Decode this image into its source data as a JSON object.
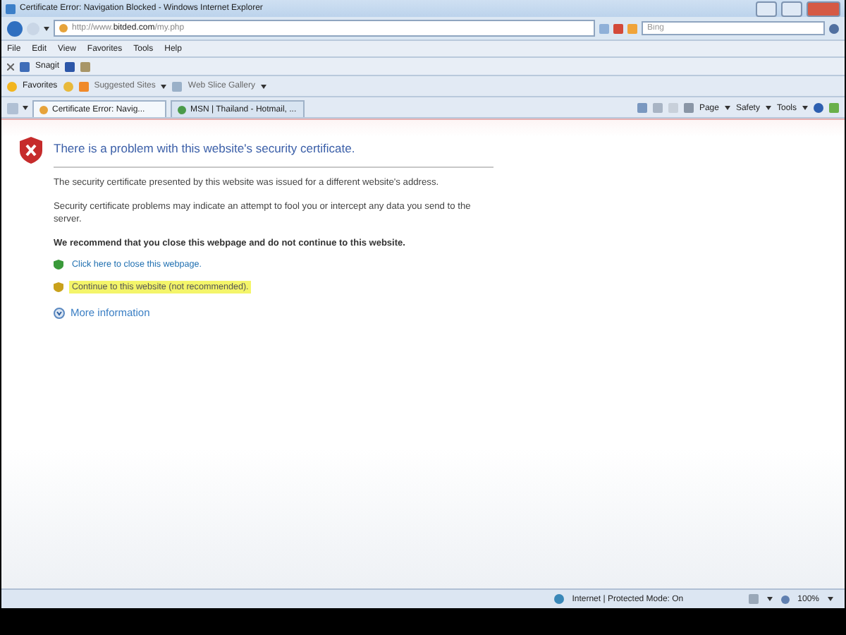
{
  "window": {
    "title": "Certificate Error: Navigation Blocked - Windows Internet Explorer"
  },
  "address_bar": {
    "url": "http://www.**bitded.com**/my.php"
  },
  "search": {
    "placeholder": "Bing"
  },
  "menu": [
    "File",
    "Edit",
    "View",
    "Favorites",
    "Tools",
    "Help"
  ],
  "snagit_toolbar": {
    "label": "Snagit"
  },
  "favorites_bar": {
    "favorites": "Favorites",
    "items": [
      "Suggested Sites",
      "Web Slice Gallery"
    ]
  },
  "tabs": [
    {
      "label": "Certificate Error: Navig...",
      "selected": true
    },
    {
      "label": "MSN | Thailand - Hotmail, ...",
      "selected": false
    }
  ],
  "command_bar": [
    "Page",
    "Safety",
    "Tools"
  ],
  "error": {
    "heading": "There is a problem with this website's security certificate.",
    "paragraphs": [
      "The security certificate presented by this website was issued for a different website's address.",
      "Security certificate problems may indicate an attempt to fool you or intercept any data you send to the server."
    ],
    "recommendation": "We recommend that you close this webpage and do not continue to this website.",
    "links": [
      {
        "kind": "close",
        "label": "Click here to close this webpage.",
        "highlighted": false
      },
      {
        "kind": "continue",
        "label": "Continue to this website (not recommended).",
        "highlighted": true
      }
    ],
    "more_info": "More information"
  },
  "status_bar": {
    "zone": "Internet | Protected Mode: On",
    "zoom": "100%"
  }
}
